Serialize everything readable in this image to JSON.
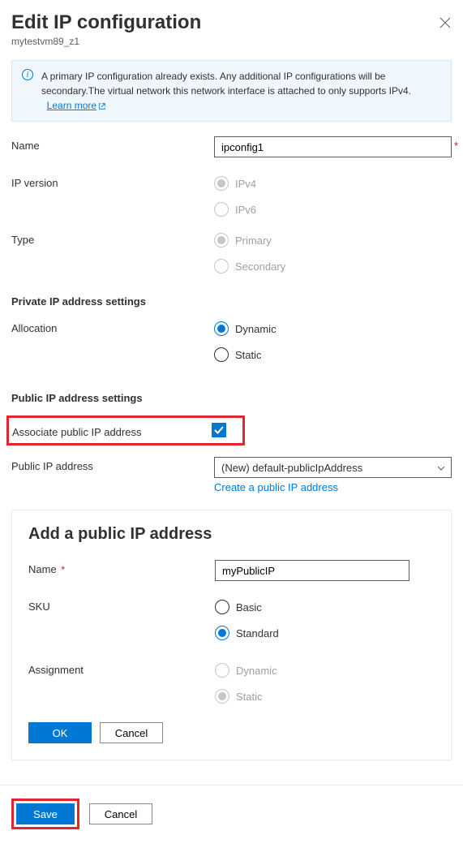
{
  "header": {
    "title": "Edit IP configuration",
    "subtitle": "mytestvm89_z1"
  },
  "info": {
    "text": "A primary IP configuration already exists. Any additional IP configurations will be secondary.The virtual network this network interface is attached to only supports IPv4.",
    "link": "Learn more"
  },
  "fields": {
    "name_label": "Name",
    "name_value": "ipconfig1",
    "ipversion_label": "IP version",
    "ipv4": "IPv4",
    "ipv6": "IPv6",
    "type_label": "Type",
    "type_primary": "Primary",
    "type_secondary": "Secondary"
  },
  "private": {
    "header": "Private IP address settings",
    "allocation_label": "Allocation",
    "dynamic": "Dynamic",
    "static": "Static"
  },
  "public": {
    "header": "Public IP address settings",
    "associate_label": "Associate public IP address",
    "address_label": "Public IP address",
    "dropdown_value": "(New) default-publicIpAddress",
    "create_link": "Create a public IP address"
  },
  "add_panel": {
    "title": "Add a public IP address",
    "name_label": "Name",
    "name_value": "myPublicIP",
    "sku_label": "SKU",
    "sku_basic": "Basic",
    "sku_standard": "Standard",
    "assignment_label": "Assignment",
    "assign_dynamic": "Dynamic",
    "assign_static": "Static",
    "ok": "OK",
    "cancel": "Cancel"
  },
  "footer": {
    "save": "Save",
    "cancel": "Cancel"
  }
}
